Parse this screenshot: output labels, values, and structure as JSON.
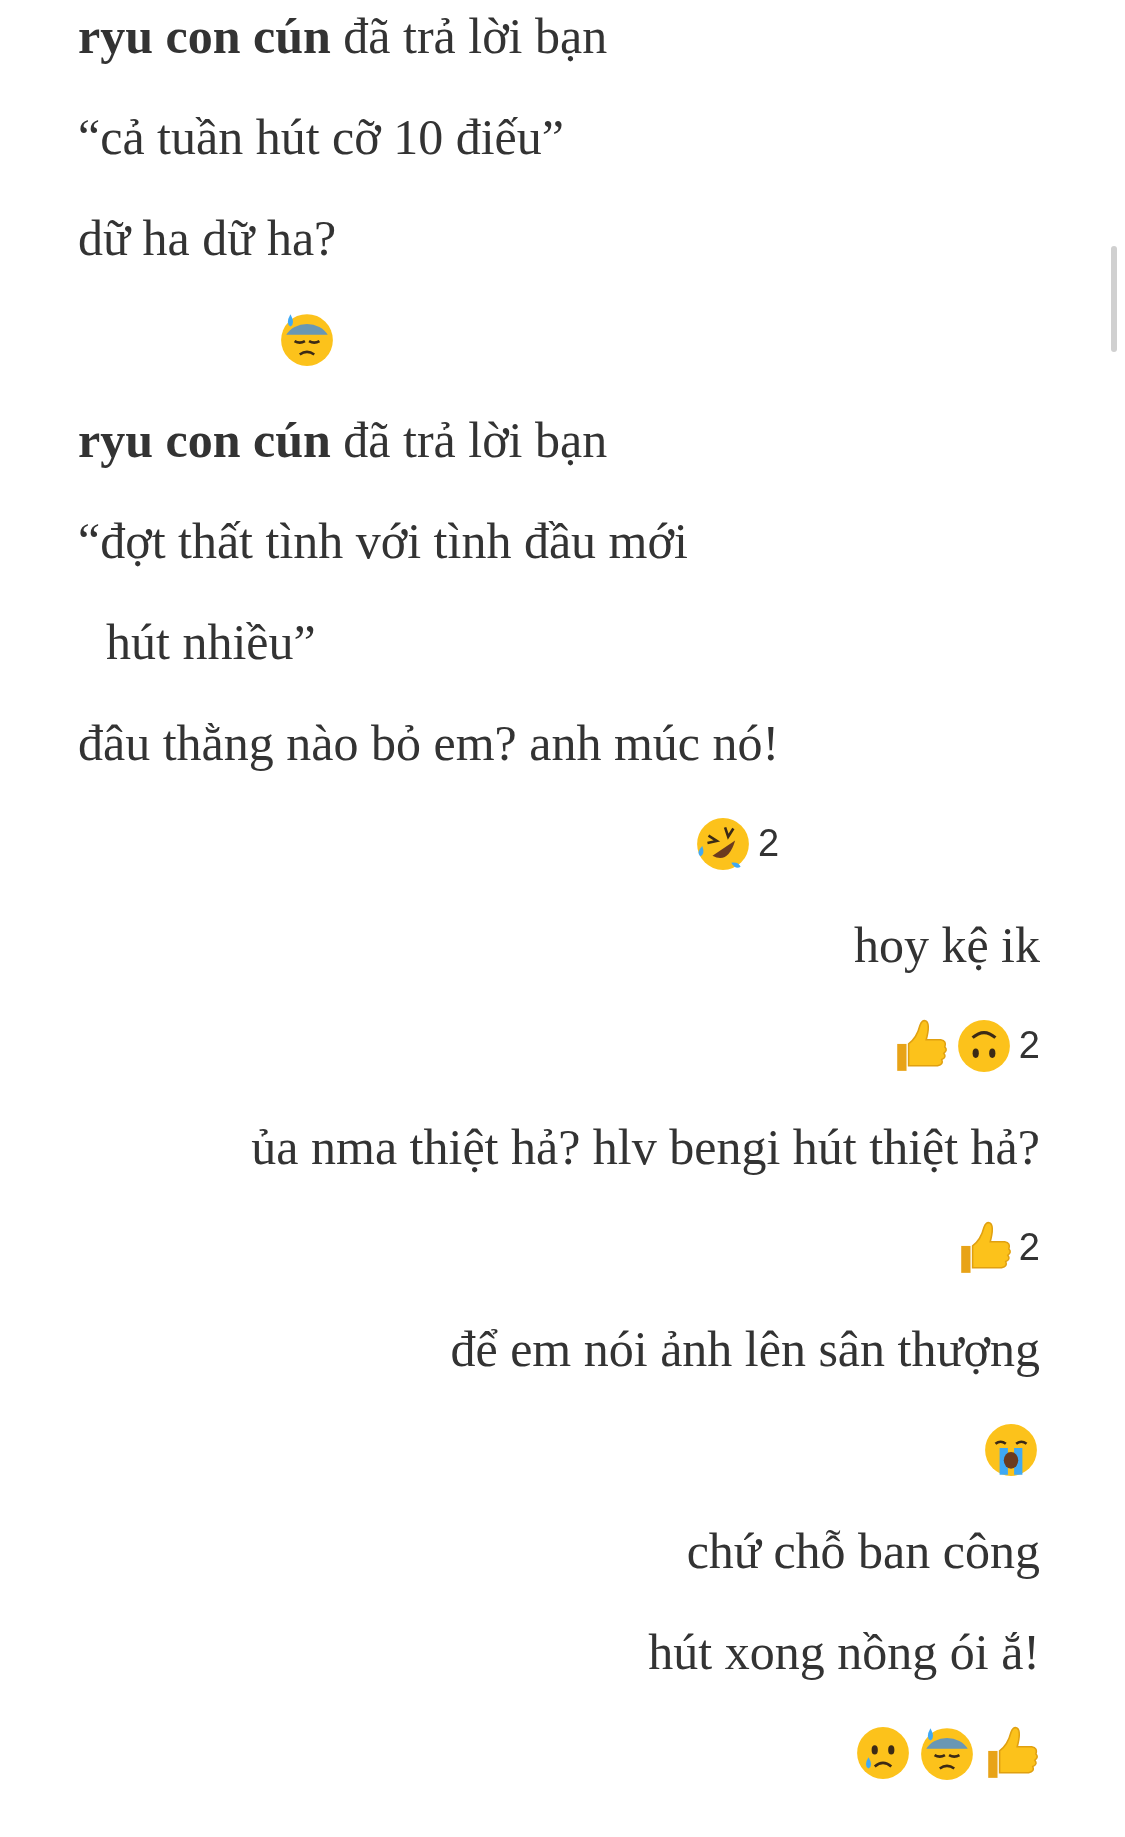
{
  "items": [
    {
      "kind": "reply_header",
      "text": "**ryu con cún** đã trả lời bạn"
    },
    {
      "kind": "quote",
      "lines": [
        "“cả tuần hút cỡ 10 điếu”"
      ]
    },
    {
      "kind": "message",
      "sent": false,
      "text": "dữ ha dữ ha?",
      "reactions": {
        "emojis": [
          {
            "kind": "sweat"
          }
        ]
      }
    },
    {
      "kind": "reply_header",
      "text": "**ryu con cún** đã trả lời bạn"
    },
    {
      "kind": "quote",
      "lines": [
        "“đợt thất tình với tình đầu mới",
        "hút nhiều”"
      ]
    },
    {
      "kind": "message",
      "sent": false,
      "text": "đâu thằng nào bỏ em? anh múc nó!",
      "reactions": {
        "emojis": [
          {
            "kind": "rofl"
          }
        ],
        "count": "2"
      }
    },
    {
      "kind": "message",
      "sent": true,
      "text": "hoy kệ ik",
      "reactions": {
        "emojis": [
          {
            "kind": "thumbs"
          },
          {
            "kind": "upside"
          }
        ],
        "count": "2"
      }
    },
    {
      "kind": "message",
      "sent": true,
      "text": "ủa nma thiệt hả? hlv bengi hút thiệt hả?",
      "reactions": {
        "emojis": [
          {
            "kind": "thumbs"
          }
        ],
        "count": "2"
      }
    },
    {
      "kind": "message",
      "sent": true,
      "text": "để em nói ảnh lên sân thượng",
      "reactions": {
        "emojis": [
          {
            "kind": "sob"
          }
        ]
      }
    },
    {
      "kind": "message",
      "sent": true,
      "text": "chứ chỗ ban công"
    },
    {
      "kind": "message",
      "sent": true,
      "text": "hút xong nồng ói ắ!",
      "reactions": {
        "emojis": [
          {
            "kind": "sad"
          },
          {
            "kind": "sweat"
          },
          {
            "kind": "thumbs"
          }
        ]
      }
    }
  ]
}
